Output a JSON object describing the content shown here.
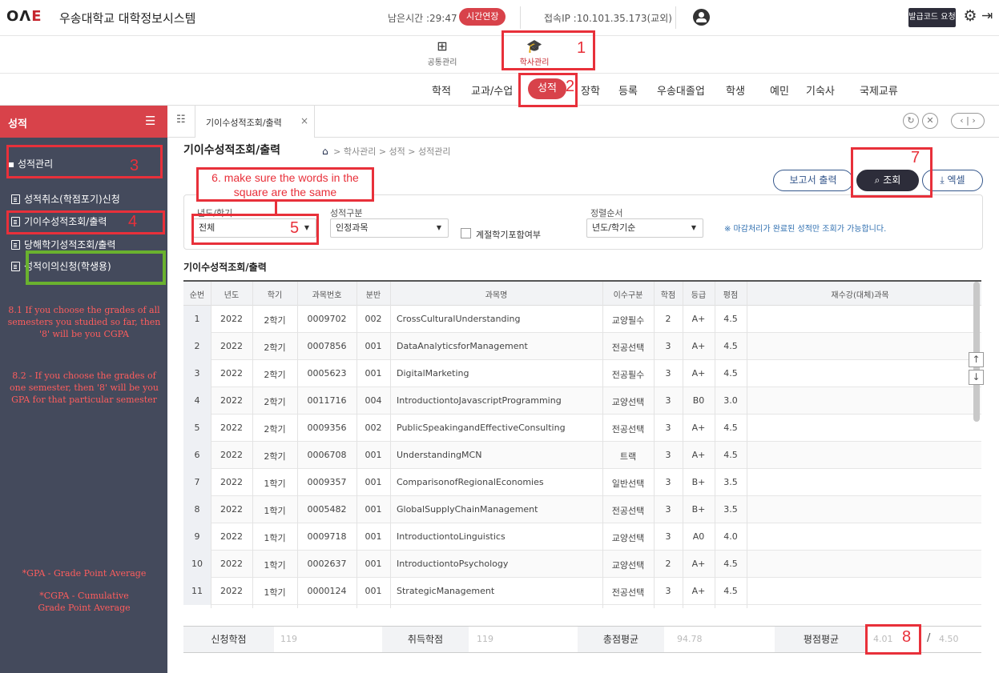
{
  "header": {
    "logo_text": "OΛ",
    "logo_accent": "E",
    "system_title": "우송대학교 대학정보시스템",
    "session_timer": "남은시간 :29:47",
    "extend_button": "시간연장",
    "access_ip": "접속IP :10.101.35.173(교외)",
    "issue_code_button": "발급코드 요청",
    "settings_icon": "gear-icon",
    "logout_icon": "logout-icon"
  },
  "modules": [
    {
      "label": "공통관리",
      "icon": "grid-icon"
    },
    {
      "label": "학사관리",
      "icon": "graduation-cap-icon"
    }
  ],
  "nav": {
    "items": [
      "학적",
      "교과/수업",
      "성적",
      "장학",
      "등록",
      "우송대졸업",
      "학생",
      "예민",
      "기숙사",
      "국제교류"
    ],
    "active": "성적"
  },
  "sidebar": {
    "title": "성적",
    "group": "성적관리",
    "items": [
      "성적취소(학점포기)신청",
      "기이수성적조회/출력",
      "당해학기성적조회/출력",
      "성적이의신청(학생용)"
    ],
    "notes": [
      "8.1 If you choose the grades of all semesters you studied so far, then '8' will be you CGPA",
      "8.2 - If you choose the grades of one semester, then '8' will be you GPA for that particular semester",
      "*GPA - Grade Point Average",
      "*CGPA - Cumulative Grade Point Average"
    ]
  },
  "tabbar": {
    "tab_label": "기이수성적조회/출력",
    "close_glyph": "×"
  },
  "page": {
    "title": "기이수성적조회/출력",
    "breadcrumb": "학사관리 > 성적 > 성적관리",
    "report_button": "보고서 출력",
    "search_button": "조회",
    "excel_button": "엑셀"
  },
  "filters": {
    "year_semester_label": "년도/학기",
    "year_semester_value": "전체",
    "grade_type_label": "성적구분",
    "grade_type_value": "인정과목",
    "seasonal_checkbox_label": "계절학기포함여부",
    "sort_label": "정렬순서",
    "sort_value": "년도/학기순",
    "notice": "※ 마감처리가 완료된 성적만 조회가 가능합니다."
  },
  "grid": {
    "title": "기이수성적조회/출력",
    "columns": [
      "순번",
      "년도",
      "학기",
      "과목번호",
      "분반",
      "과목명",
      "이수구분",
      "학점",
      "등급",
      "평점",
      "재수강(대체)과목"
    ],
    "rows": [
      [
        "1",
        "2022",
        "2학기",
        "0009702",
        "002",
        "CrossCulturalUnderstanding",
        "교양필수",
        "2",
        "A+",
        "4.5"
      ],
      [
        "2",
        "2022",
        "2학기",
        "0007856",
        "001",
        "DataAnalyticsforManagement",
        "전공선택",
        "3",
        "A+",
        "4.5"
      ],
      [
        "3",
        "2022",
        "2학기",
        "0005623",
        "001",
        "DigitalMarketing",
        "전공필수",
        "3",
        "A+",
        "4.5"
      ],
      [
        "4",
        "2022",
        "2학기",
        "0011716",
        "004",
        "IntroductiontoJavascriptProgramming",
        "교양선택",
        "3",
        "B0",
        "3.0"
      ],
      [
        "5",
        "2022",
        "2학기",
        "0009356",
        "002",
        "PublicSpeakingandEffectiveConsulting",
        "전공선택",
        "3",
        "A+",
        "4.5"
      ],
      [
        "6",
        "2022",
        "2학기",
        "0006708",
        "001",
        "UnderstandingMCN",
        "트랙",
        "3",
        "A+",
        "4.5"
      ],
      [
        "7",
        "2022",
        "1학기",
        "0009357",
        "001",
        "ComparisonofRegionalEconomies",
        "일반선택",
        "3",
        "B+",
        "3.5"
      ],
      [
        "8",
        "2022",
        "1학기",
        "0005482",
        "001",
        "GlobalSupplyChainManagement",
        "전공선택",
        "3",
        "B+",
        "3.5"
      ],
      [
        "9",
        "2022",
        "1학기",
        "0009718",
        "001",
        "IntroductiontoLinguistics",
        "교양선택",
        "3",
        "A0",
        "4.0"
      ],
      [
        "10",
        "2022",
        "1학기",
        "0002637",
        "001",
        "IntroductiontoPsychology",
        "교양선택",
        "2",
        "A+",
        "4.5"
      ],
      [
        "11",
        "2022",
        "1학기",
        "0000124",
        "001",
        "StrategicManagement",
        "전공선택",
        "3",
        "A+",
        "4.5"
      ]
    ]
  },
  "summary": {
    "applied_credits_label": "신청학점",
    "applied_credits": "119",
    "earned_credits_label": "취득학점",
    "earned_credits": "119",
    "total_average_label": "총점평균",
    "total_average": "94.78",
    "gpa_label": "평점평균",
    "gpa": "4.01",
    "gpa_separator": "/",
    "gpa_max": "4.50"
  },
  "annotations": {
    "n1": "1",
    "n2": "2",
    "n3": "3",
    "n4": "4",
    "n5": "5",
    "n7": "7",
    "n8": "8",
    "note6": "6. make sure the words in the square are the same"
  },
  "colors": {
    "accent_red": "#d8424a",
    "sidebar_bg": "#444a5c",
    "dark_button": "#2d2d3a",
    "annotation_red": "#e8303a",
    "annotation_green": "#6ab22f"
  }
}
